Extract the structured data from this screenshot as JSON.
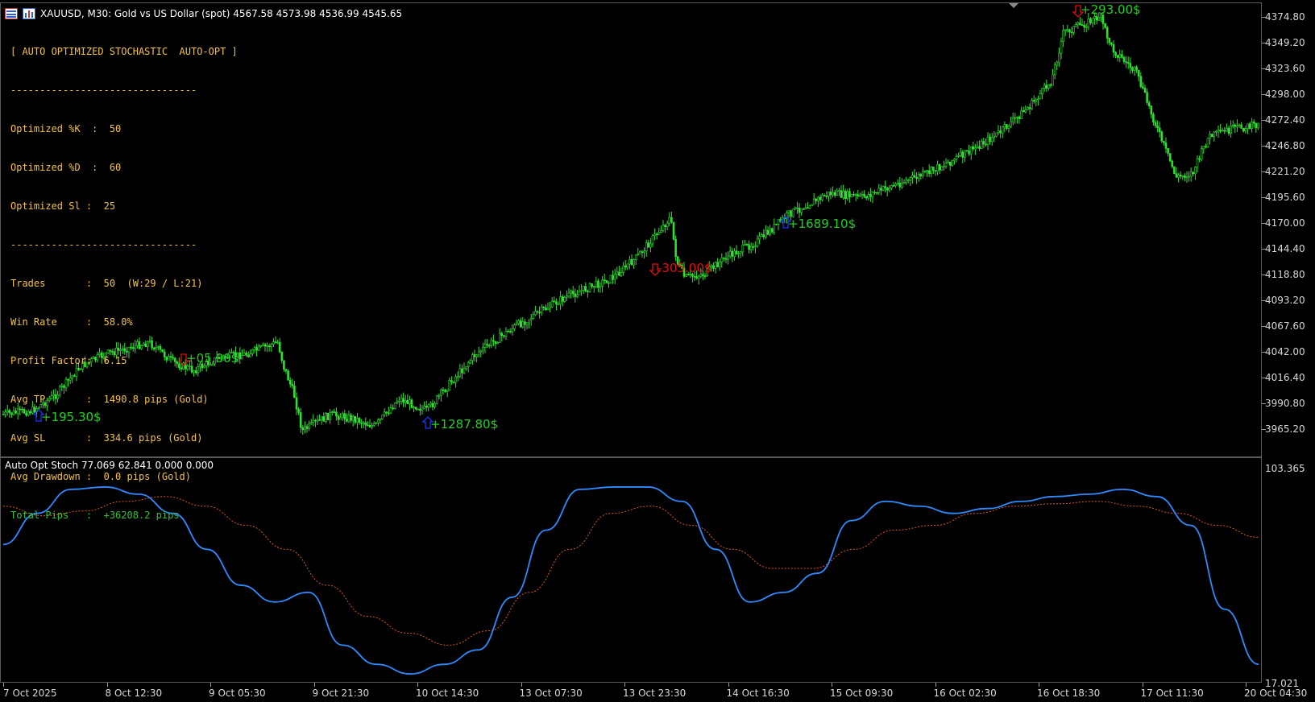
{
  "window": {
    "symbol_title": "XAUUSD, M30:  Gold vs US Dollar (spot)  4567.58 4573.98 4536.99 4545.65"
  },
  "stats": {
    "header": "[ AUTO OPTIMIZED STOCHASTIC  AUTO-OPT ]",
    "divider": "--------------------------------",
    "opt_k": "Optimized %K  :  50",
    "opt_d": "Optimized %D  :  60",
    "opt_sl": "Optimized Sl :  25",
    "divider2": "--------------------------------",
    "trades": "Trades       :  50  (W:29 / L:21)",
    "win_rate": "Win Rate     :  58.0%",
    "profit_factor": "Profit Factor:  6.15",
    "avg_tp": "Avg TP       :  1490.8 pips (Gold)",
    "avg_sl": "Avg SL       :  334.6 pips (Gold)",
    "avg_drawdown": "Avg Drawdown :  0.0 pips (Gold)",
    "total_pips": "Total Pips   :  +36208.2 pips"
  },
  "price_axis": [
    "4374.80",
    "4349.20",
    "4323.60",
    "4298.00",
    "4272.40",
    "4246.80",
    "4221.20",
    "4195.60",
    "4170.00",
    "4144.40",
    "4118.80",
    "4093.20",
    "4067.60",
    "4042.00",
    "4016.40",
    "3990.80",
    "3965.20"
  ],
  "indicator_axis": [
    "103.365",
    "17.021"
  ],
  "indicator": {
    "title": "Auto Opt Stoch 77.069 62.841 0.000 0.000"
  },
  "time_axis": [
    "7 Oct 2025",
    "8 Oct 12:30",
    "9 Oct 05:30",
    "9 Oct 21:30",
    "10 Oct 14:30",
    "13 Oct 07:30",
    "13 Oct 23:30",
    "14 Oct 16:30",
    "15 Oct 09:30",
    "16 Oct 02:30",
    "16 Oct 18:30",
    "17 Oct 11:30",
    "20 Oct 04:30"
  ],
  "trades": [
    {
      "label": "+195.30$",
      "dir": "buy",
      "color": "#22d022"
    },
    {
      "label": "+05.00$",
      "dir": "sell",
      "color": "#22d022"
    },
    {
      "label": "+1287.80$",
      "dir": "buy",
      "color": "#22d022"
    },
    {
      "label": "-305.00$",
      "dir": "sell",
      "color": "#e01010"
    },
    {
      "label": "+1689.10$",
      "dir": "buy",
      "color": "#22d022"
    },
    {
      "label": "+293.00$",
      "dir": "sell",
      "color": "#22d022"
    }
  ],
  "colors": {
    "candle": "#2fe02f",
    "k_line": "#2e8bff",
    "d_line": "#e0561a",
    "buy_arrow": "#1a35ff",
    "sell_arrow": "#e01010",
    "stats_text": "#f5c342",
    "total_pips": "#34c234"
  },
  "chart_data": {
    "type": "line",
    "series": [
      {
        "name": "%K",
        "values": [
          72,
          85,
          95,
          96,
          93,
          85,
          70,
          55,
          48,
          52,
          30,
          22,
          18,
          22,
          28,
          50,
          78,
          95,
          96,
          96,
          90,
          70,
          48,
          52,
          60,
          82,
          90,
          88,
          85,
          87,
          90,
          92,
          93,
          95,
          92,
          80,
          45,
          22
        ]
      },
      {
        "name": "%D",
        "values": [
          88,
          84,
          86,
          90,
          92,
          88,
          80,
          70,
          55,
          42,
          35,
          30,
          36,
          52,
          70,
          85,
          88,
          80,
          70,
          62,
          62,
          70,
          78,
          80,
          85,
          88,
          89,
          90,
          88,
          85,
          80,
          75
        ]
      }
    ],
    "ylim": [
      17.021,
      103.365
    ]
  }
}
